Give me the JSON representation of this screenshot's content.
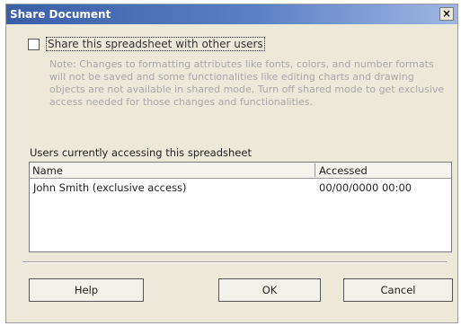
{
  "window": {
    "title": "Share Document",
    "close_glyph": "×"
  },
  "share": {
    "checked": false,
    "label": "Share this spreadsheet with other users"
  },
  "note": "Note: Changes to formatting attributes like fonts, colors, and number formats will not be saved and some functionalities like editing charts and drawing objects are not available in shared mode. Turn off shared mode to get exclusive access needed for those changes and functionalities.",
  "users": {
    "label": "Users currently accessing this spreadsheet",
    "columns": [
      "Name",
      "Accessed"
    ],
    "rows": [
      {
        "name": "John Smith (exclusive access)",
        "accessed": "00/00/0000 00:00"
      }
    ]
  },
  "buttons": {
    "help": "Help",
    "ok": "OK",
    "cancel": "Cancel"
  }
}
